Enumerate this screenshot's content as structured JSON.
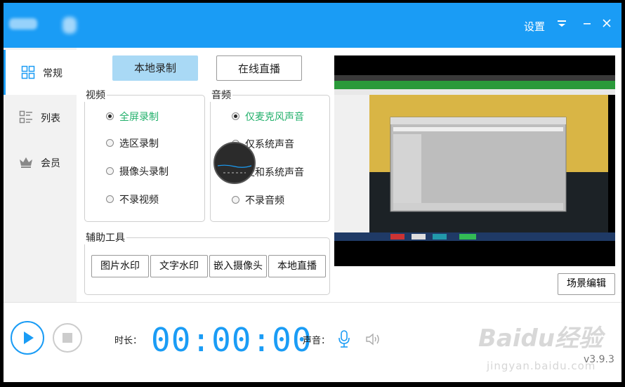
{
  "titlebar": {
    "settings_label": "设置",
    "menu_icon": "menu-icon",
    "minimize_icon": "minimize-icon",
    "close_icon": "close-icon"
  },
  "sidebar": {
    "items": [
      {
        "label": "常规",
        "icon": "grid-icon",
        "active": true
      },
      {
        "label": "列表",
        "icon": "list-icon",
        "active": false
      },
      {
        "label": "会员",
        "icon": "crown-icon",
        "active": false
      }
    ]
  },
  "modes": {
    "local": "本地录制",
    "live": "在线直播"
  },
  "video": {
    "title": "视频",
    "options": [
      "全屏录制",
      "选区录制",
      "摄像头录制",
      "不录视频"
    ],
    "selected": "全屏录制"
  },
  "audio": {
    "title": "音频",
    "options": [
      "仅麦克风声音",
      "仅系统声音",
      "麦和系统声音",
      "不录音频"
    ],
    "selected": "仅麦克风声音"
  },
  "tools": {
    "title": "辅助工具",
    "buttons": [
      "图片水印",
      "文字水印",
      "嵌入摄像头",
      "本地直播"
    ]
  },
  "scene_button": "场景编辑",
  "controls": {
    "duration_label": "时长：",
    "duration_value": "00:00:00",
    "sound_label": "声音："
  },
  "version": "v3.9.3",
  "watermark": {
    "brand": "Baidu经验",
    "url": "jingyan.baidu.com"
  },
  "colors": {
    "accent": "#1a9cf5",
    "selected_text": "#22b06b"
  }
}
